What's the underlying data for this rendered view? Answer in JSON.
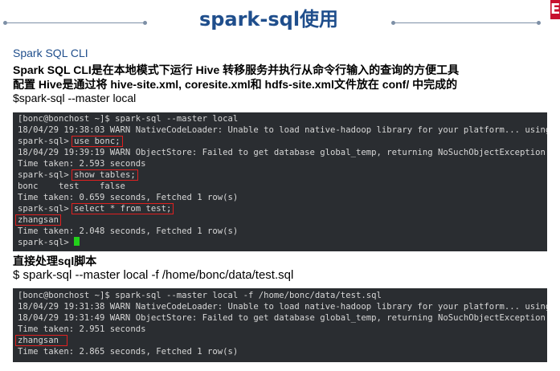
{
  "slide": {
    "title": "spark-sql使用",
    "subtitle": "Spark SQL CLI",
    "line1": "Spark SQL CLI是在本地模式下运行 Hive 转移服务并执行从命令行输入的查询的方便工具",
    "line2": "配置 Hive是通过将 hive-site.xml, coresite.xml和 hdfs-site.xml文件放在 conf/ 中完成的",
    "line3": "$spark-sql --master local",
    "section2": "直接处理sql脚本",
    "cmd2": "$ spark-sql --master local -f /home/bonc/data/test.sql",
    "logo_text": "E"
  },
  "terminal1": {
    "l1": "[bonc@bonchost ~]$ spark-sql --master local",
    "l2": "18/04/29 19:38:03 WARN NativeCodeLoader: Unable to load native-hadoop library for your platform... using",
    "l3_prompt": "spark-sql> ",
    "l3_cmd": "use bonc;",
    "l4": "18/04/29 19:39:19 WARN ObjectStore: Failed to get database global_temp, returning NoSuchObjectException",
    "l5": "Time taken: 2.593 seconds",
    "l6_prompt": "spark-sql> ",
    "l6_cmd": "show tables;",
    "l7": "bonc    test    false",
    "l8": "Time taken: 0.659 seconds, Fetched 1 row(s)",
    "l9_prompt": "spark-sql> ",
    "l9_cmd": "select * from test;",
    "l10": "zhangsan",
    "l11": "Time taken: 2.048 seconds, Fetched 1 row(s)",
    "l12_prompt": "spark-sql> "
  },
  "terminal2": {
    "l1": "[bonc@bonchost ~]$ spark-sql --master local -f /home/bonc/data/test.sql",
    "l2": "18/04/29 19:31:38 WARN NativeCodeLoader: Unable to load native-hadoop library for your platform... using",
    "l3": "18/04/29 19:31:49 WARN ObjectStore: Failed to get database global_temp, returning NoSuchObjectException",
    "l4": "Time taken: 2.951 seconds",
    "l5": "zhangsan",
    "l6": "Time taken: 2.865 seconds, Fetched 1 row(s)"
  },
  "colors": {
    "title": "#1f4e8c",
    "terminal_bg": "#2a2d31",
    "terminal_text": "#d7d7d7",
    "highlight_box": "#e02020",
    "cursor": "#22d11a",
    "logo": "#c8102e"
  }
}
